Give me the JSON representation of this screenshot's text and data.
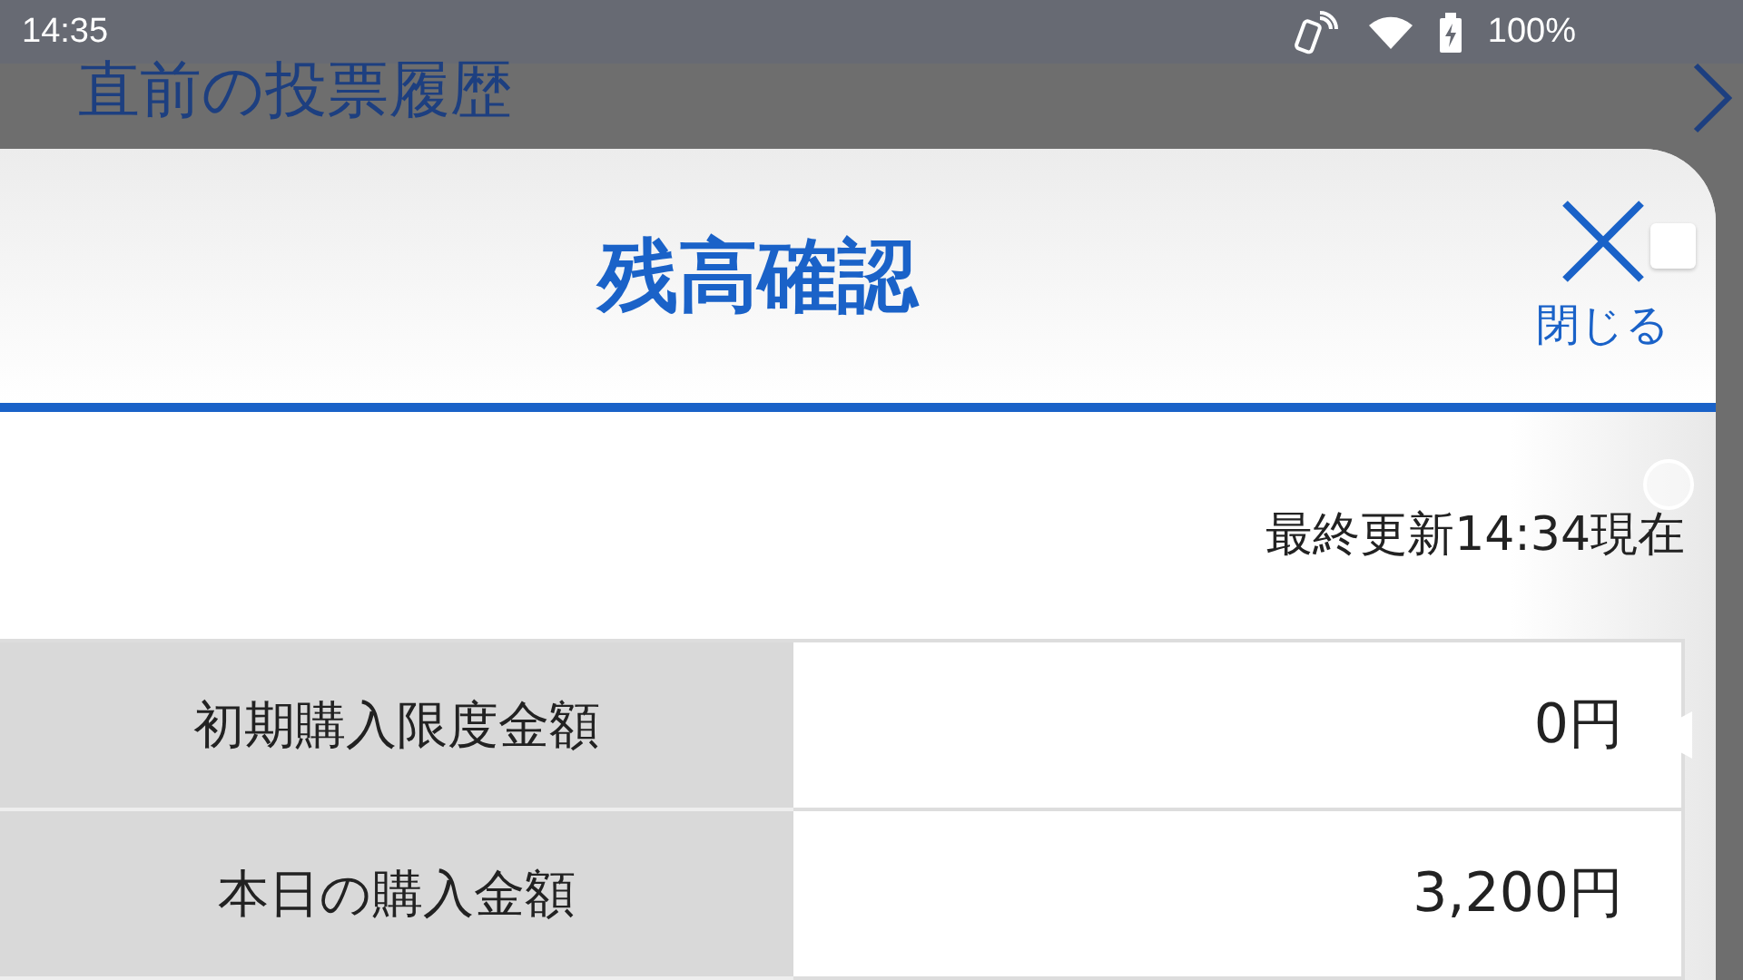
{
  "status_bar": {
    "time": "14:35",
    "battery": "100%"
  },
  "background": {
    "title": "直前の投票履歴"
  },
  "dialog": {
    "title": "残高確認",
    "close_label": "閉じる",
    "updated": "最終更新14:34現在",
    "rows": [
      {
        "label": "初期購入限度金額",
        "value": "0円"
      },
      {
        "label": "本日の購入金額",
        "value": "3,200円"
      }
    ]
  }
}
